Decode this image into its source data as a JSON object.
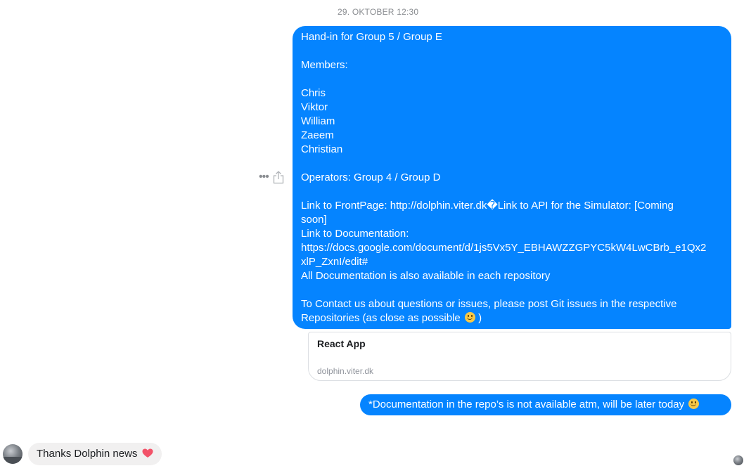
{
  "thread": {
    "timestamp": "29. OKTOBER 12:30",
    "tools": {
      "more_icon": "more-options-icon",
      "share_icon": "share-icon"
    },
    "main_message": {
      "lines": [
        "Hand-in for Group 5 / Group E",
        "",
        "Members:",
        "",
        "Chris",
        "Viktor",
        "William",
        "Zaeem",
        "Christian",
        "",
        "Operators: Group 4 / Group D",
        "",
        "Link to FrontPage: http://dolphin.viter.dk�Link to API for the Simulator: [Coming",
        "soon]",
        "Link to Documentation:",
        "https://docs.google.com/document/d/1js5Vx5Y_EBHAWZZGPYC5kW4LwCBrb_e1Qx2",
        "xlP_ZxnI/edit#",
        "All Documentation is also available in each repository",
        "",
        "To Contact us about questions or issues, please post Git issues in the respective",
        "Repositories (as close as possible"
      ],
      "last_line_suffix": ")",
      "emoji": "smile-icon"
    },
    "link_preview": {
      "title": "React App",
      "domain": "dolphin.viter.dk"
    },
    "note_message": {
      "text": "*Documentation in the repo’s is not available atm, will be later today",
      "emoji": "smile-icon"
    },
    "incoming_message": {
      "text": "Thanks Dolphin news",
      "emoji": "heart-icon",
      "heart_color": "#f25268"
    },
    "colors": {
      "outgoing_bubble": "#0584ff",
      "incoming_bubble": "#f1f0f0"
    }
  }
}
